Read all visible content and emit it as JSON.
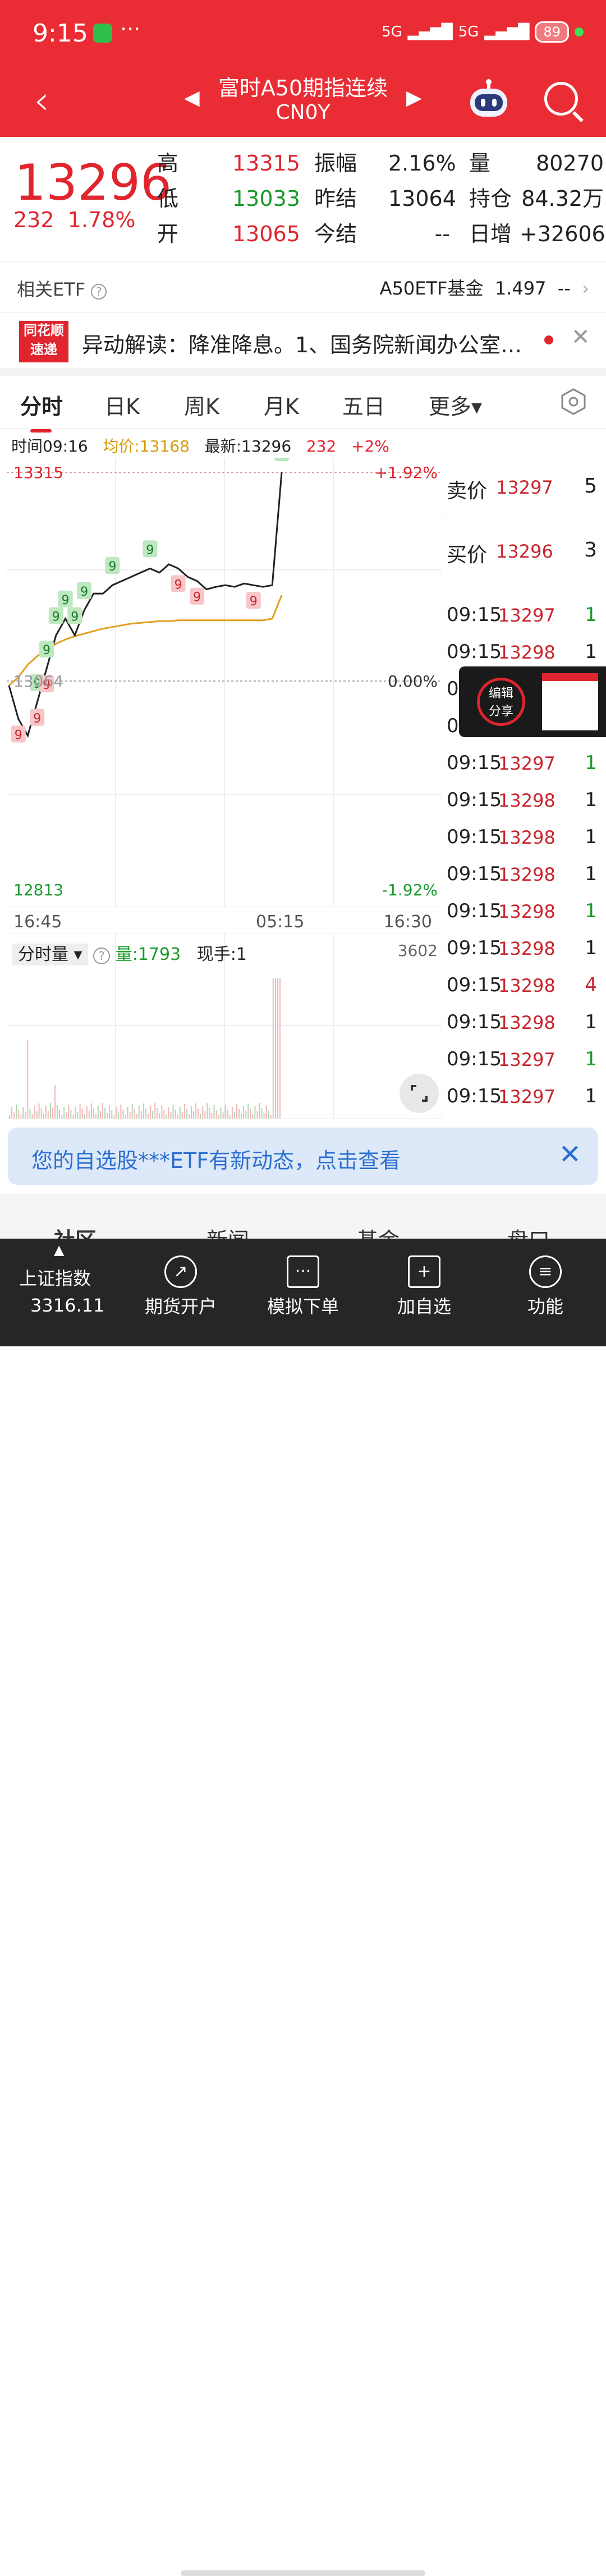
{
  "status": {
    "time": "9:15",
    "more": "···",
    "battery": "89",
    "net1": "5G",
    "net2": "5G"
  },
  "title": {
    "name": "富时A50期指连续",
    "code": "CN0Y"
  },
  "quote": {
    "price": "13296",
    "change": "232",
    "pct": "1.78%",
    "rows": [
      [
        "高",
        "13315",
        "振幅",
        "2.16%",
        "量",
        "80270"
      ],
      [
        "低",
        "13033",
        "昨结",
        "13064",
        "持仓",
        "84.32万"
      ],
      [
        "开",
        "13065",
        "今结",
        "--",
        "日增",
        "+32606"
      ]
    ]
  },
  "etf": {
    "label": "相关ETF",
    "name": "A50ETF基金",
    "value": "1.497",
    "change": "--"
  },
  "news": {
    "logo1": "同花顺",
    "logo2": "速递",
    "text": "异动解读：降准降息。1、国务院新闻办公室…"
  },
  "tabs": [
    "分时",
    "日K",
    "周K",
    "月K",
    "五日",
    "更多▾"
  ],
  "info": {
    "time": "时间09:16",
    "avg": "均价:13168",
    "last": "最新:13296",
    "chg": "232",
    "pct": "+2%"
  },
  "chart_data": {
    "type": "line",
    "ymax": "13315",
    "ymin": "12813",
    "ymid": "13064",
    "pmax": "+1.92%",
    "pmin": "-1.92%",
    "pmid": "0.00%",
    "xticks": [
      "16:45",
      "05:15",
      "16:30"
    ],
    "price": [
      13060,
      13020,
      13000,
      13040,
      13080,
      13120,
      13140,
      13120,
      13150,
      13170,
      13170,
      13180,
      13185,
      13190,
      13195,
      13200,
      13195,
      13205,
      13200,
      13190,
      13185,
      13175,
      13178,
      13180,
      13178,
      13182,
      13180,
      13178,
      13180,
      13315
    ],
    "avg": [
      13060,
      13070,
      13085,
      13095,
      13103,
      13110,
      13115,
      13119,
      13122,
      13125,
      13128,
      13130,
      13132,
      13134,
      13135,
      13136,
      13137,
      13137,
      13138,
      13138,
      13138,
      13138,
      13138,
      13138,
      13138,
      13138,
      13138,
      13138,
      13140,
      13168
    ],
    "markers": [
      "9",
      "9",
      "9",
      "9",
      "9",
      "9",
      "9",
      "9",
      "9",
      "9",
      "9",
      "9",
      "9",
      "9",
      "9"
    ]
  },
  "volume": {
    "label": "分时量",
    "vol": "量:1793",
    "hand": "现手:1",
    "max": "3602"
  },
  "orderbook": {
    "ask_label": "卖价",
    "ask": "13297",
    "ask_q": "5",
    "bid_label": "买价",
    "bid": "13296",
    "bid_q": "3"
  },
  "trades": [
    [
      "09:15",
      "13297",
      "1"
    ],
    [
      "09:15",
      "13298",
      "1"
    ],
    [
      "09:15",
      "13298",
      "1"
    ],
    [
      "09:15",
      "13297",
      "1"
    ],
    [
      "09:15",
      "13297",
      "1"
    ],
    [
      "09:15",
      "13298",
      "1"
    ],
    [
      "09:15",
      "13298",
      "1"
    ],
    [
      "09:15",
      "13298",
      "1"
    ],
    [
      "09:15",
      "13298",
      "1"
    ],
    [
      "09:15",
      "13298",
      "1"
    ],
    [
      "09:15",
      "13298",
      "4"
    ],
    [
      "09:15",
      "13298",
      "1"
    ],
    [
      "09:15",
      "13297",
      "1"
    ],
    [
      "09:15",
      "13297",
      "1"
    ]
  ],
  "share": {
    "label1": "编辑",
    "label2": "分享"
  },
  "banner": {
    "text": "您的自选股***ETF有新动态，点击查看"
  },
  "peek": [
    "社区",
    "新闻",
    "基金",
    "盘口"
  ],
  "bottom": {
    "index_name": "上证指数",
    "index_value": "3316.11",
    "items": [
      "期货开户",
      "模拟下单",
      "加自选",
      "功能"
    ]
  }
}
